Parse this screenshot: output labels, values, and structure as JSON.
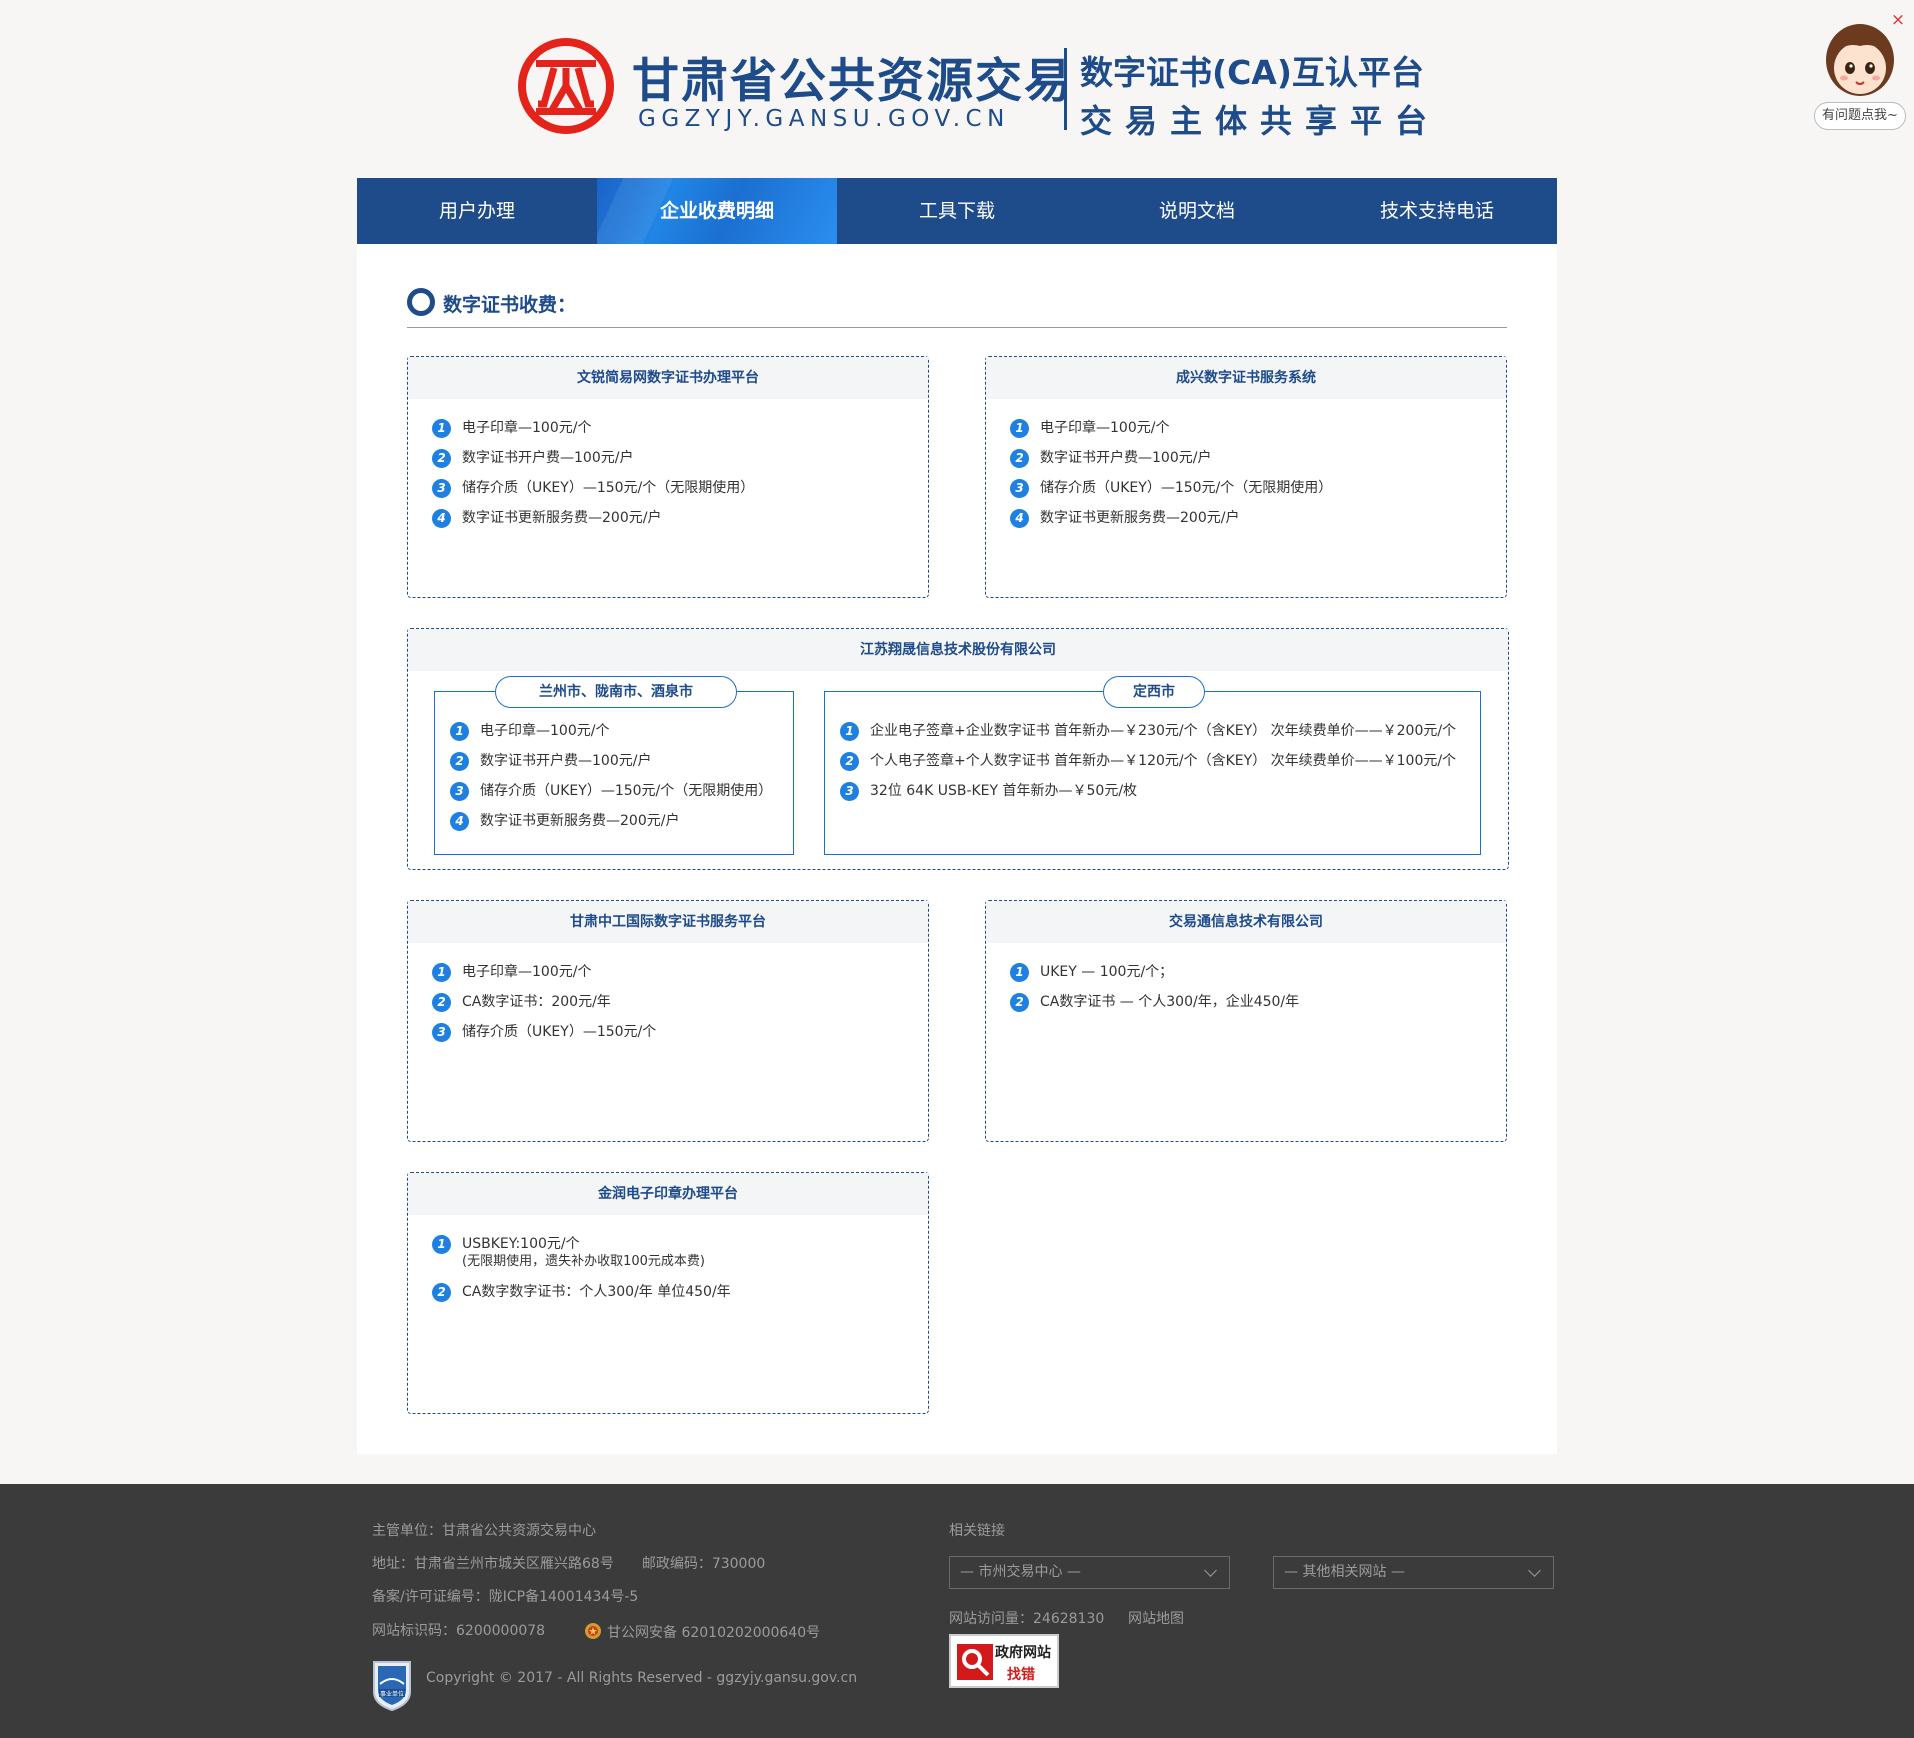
{
  "header": {
    "site_title": "甘肃省公共资源交易",
    "site_domain": "GGZYJY.GANSU.GOV.CN",
    "platform_line1": "数字证书(CA)互认平台",
    "platform_line2": "交易主体共享平台"
  },
  "helper": {
    "bubble_text": "有问题点我~",
    "close_label": "×"
  },
  "nav": {
    "active_index": 1,
    "items": [
      {
        "label": "用户办理"
      },
      {
        "label": "企业收费明细"
      },
      {
        "label": "工具下载"
      },
      {
        "label": "说明文档"
      },
      {
        "label": "技术支持电话"
      }
    ]
  },
  "section": {
    "title": "数字证书收费："
  },
  "cards": {
    "wenrui": {
      "title": "文锐简易网数字证书办理平台",
      "items": [
        {
          "num": "1",
          "text": "电子印章—100元/个"
        },
        {
          "num": "2",
          "text": "数字证书开户费—100元/户"
        },
        {
          "num": "3",
          "text": "储存介质（UKEY）—150元/个（无限期使用）"
        },
        {
          "num": "4",
          "text": "数字证书更新服务费—200元/户"
        }
      ]
    },
    "chengxing": {
      "title": "成兴数字证书服务系统",
      "items": [
        {
          "num": "1",
          "text": "电子印章—100元/个"
        },
        {
          "num": "2",
          "text": "数字证书开户费—100元/户"
        },
        {
          "num": "3",
          "text": "储存介质（UKEY）—150元/个（无限期使用）"
        },
        {
          "num": "4",
          "text": "数字证书更新服务费—200元/户"
        }
      ]
    },
    "jiangsu": {
      "title": "江苏翔晟信息技术股份有限公司",
      "left_tab": "兰州市、陇南市、酒泉市",
      "left_items": [
        {
          "num": "1",
          "text": "电子印章—100元/个"
        },
        {
          "num": "2",
          "text": "数字证书开户费—100元/户"
        },
        {
          "num": "3",
          "text": "储存介质（UKEY）—150元/个（无限期使用）"
        },
        {
          "num": "4",
          "text": "数字证书更新服务费—200元/户"
        }
      ],
      "right_tab": "定西市",
      "right_items": [
        {
          "num": "1",
          "text": "企业电子签章+企业数字证书 首年新办—￥230元/个（含KEY） 次年续费单价——￥200元/个"
        },
        {
          "num": "2",
          "text": "个人电子签章+个人数字证书 首年新办—￥120元/个（含KEY） 次年续费单价——￥100元/个"
        },
        {
          "num": "3",
          "text": "32位 64K USB-KEY 首年新办—￥50元/枚"
        }
      ]
    },
    "zhonggong": {
      "title": "甘肃中工国际数字证书服务平台",
      "items": [
        {
          "num": "1",
          "text": "电子印章—100元/个"
        },
        {
          "num": "2",
          "text": "CA数字证书：200元/年"
        },
        {
          "num": "3",
          "text": "储存介质（UKEY）—150元/个"
        }
      ]
    },
    "jiaoyitong": {
      "title": "交易通信息技术有限公司",
      "items": [
        {
          "num": "1",
          "text": "UKEY — 100元/个；"
        },
        {
          "num": "2",
          "text": "CA数字证书 — 个人300/年，企业450/年"
        }
      ]
    },
    "jinrun": {
      "title": "金润电子印章办理平台",
      "item1_num": "1",
      "item1_text": "USBKEY:100元/个",
      "item1_note": "(无限期使用，遗失补办收取100元成本费)",
      "item2_num": "2",
      "item2_text": "CA数字数字证书：个人300/年 单位450/年"
    }
  },
  "footer": {
    "authority": "主管单位：甘肃省公共资源交易中心",
    "address": "地址：甘肃省兰州市城关区雁兴路68号　　邮政编码：730000",
    "icp": "备案/许可证编号：陇ICP备14001434号-5",
    "site_code": "网站标识码：6200000078",
    "police_record": "甘公网安备 62010202000640号",
    "copyright": "Copyright © 2017 - All Rights Reserved - ggzyjy.gansu.gov.cn",
    "related_links_label": "相关链接",
    "select_city": "— 市州交易中心 —",
    "select_other": "— 其他相关网站 —",
    "visits": "网站访问量：24628130",
    "sitemap": "网站地图",
    "err_line1": "政府网站",
    "err_line2": "找错",
    "badge_text": "事业单位"
  },
  "colors": {
    "brand_blue": "#1e4b8a",
    "active_blue": "#2185e6",
    "bullet_blue": "#1e80e0",
    "logo_red": "#e4231b",
    "footer_bg": "#3b3b3b"
  }
}
